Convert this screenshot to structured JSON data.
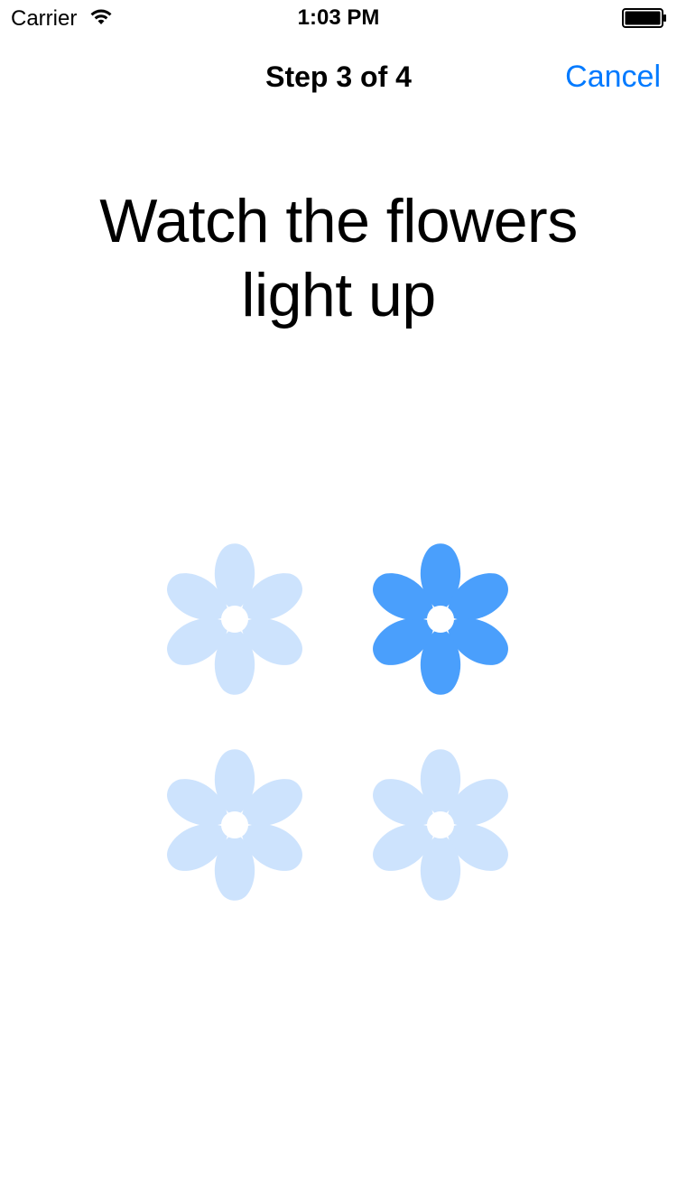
{
  "status_bar": {
    "carrier": "Carrier",
    "time": "1:03 PM",
    "wifi_icon": "wifi-icon",
    "battery_icon": "battery-icon"
  },
  "nav": {
    "title": "Step 3 of 4",
    "cancel_label": "Cancel"
  },
  "instruction": {
    "line1": "Watch the flowers",
    "line2": "light up"
  },
  "colors": {
    "accent": "#007aff",
    "flower_lit": "#4a9ffc",
    "flower_dim": "#cde3fd"
  },
  "flowers": [
    {
      "icon": "flower-icon",
      "lit": false
    },
    {
      "icon": "flower-icon",
      "lit": true
    },
    {
      "icon": "flower-icon",
      "lit": false
    },
    {
      "icon": "flower-icon",
      "lit": false
    }
  ]
}
